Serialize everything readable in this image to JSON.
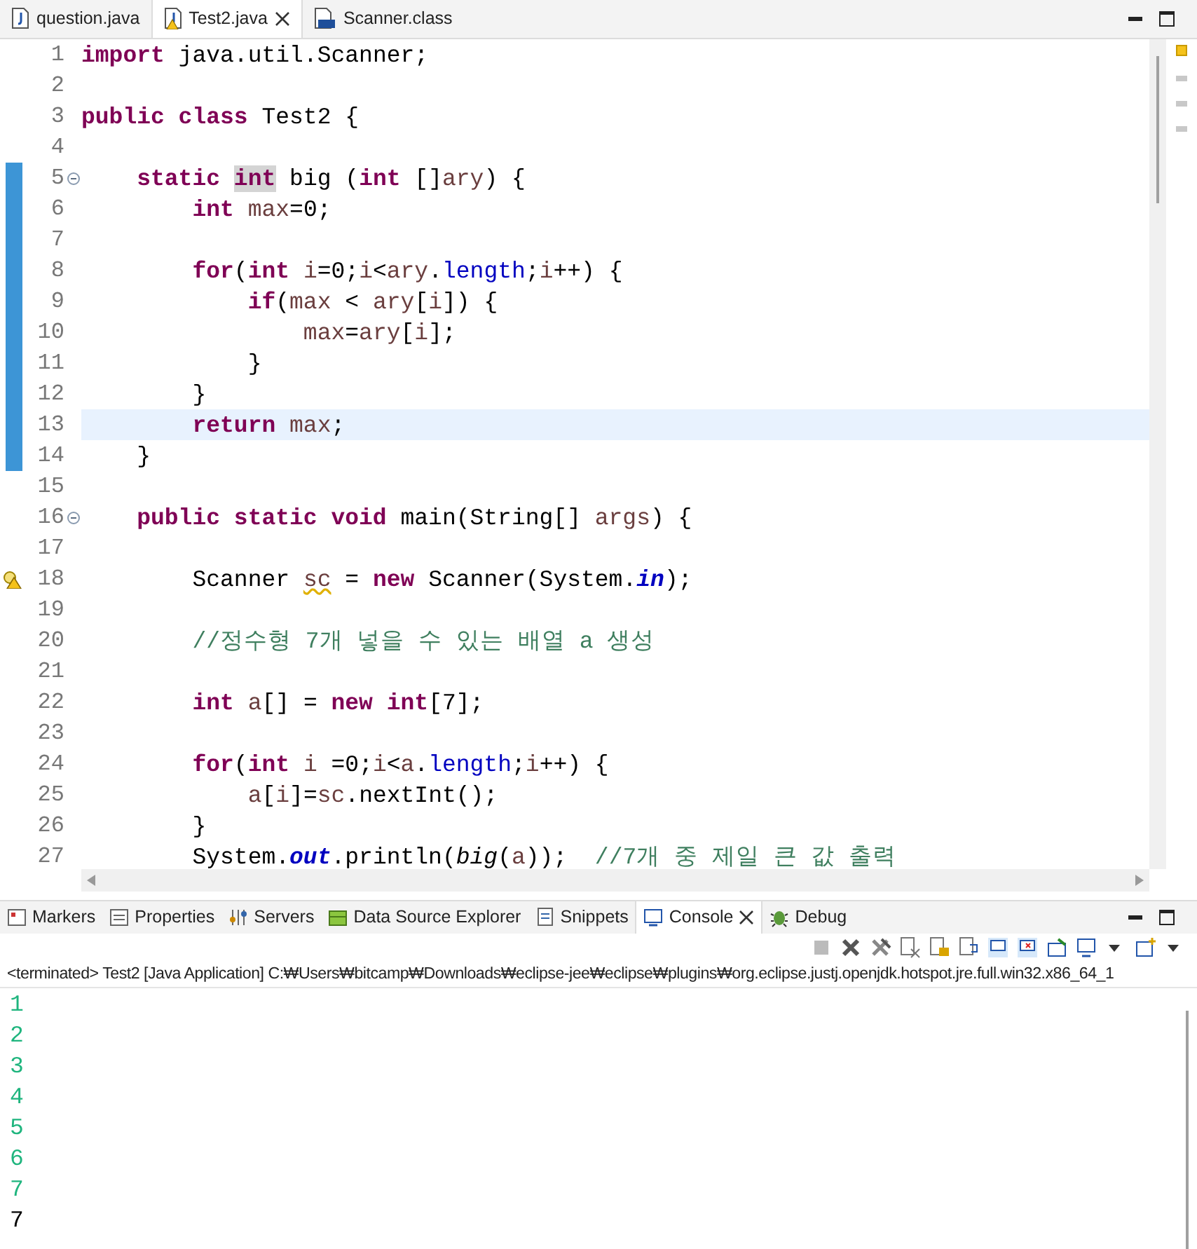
{
  "editor_tabs": [
    {
      "label": "question.java",
      "kind": "java",
      "selected": false,
      "warning": false,
      "closable": false
    },
    {
      "label": "Test2.java",
      "kind": "java",
      "selected": true,
      "warning": true,
      "closable": true
    },
    {
      "label": "Scanner.class",
      "kind": "class",
      "selected": false,
      "warning": false,
      "closable": false
    }
  ],
  "code": {
    "lines": [
      {
        "number": "1",
        "tokens": [
          {
            "kind": "keyword",
            "text": "import"
          },
          {
            "kind": "plain",
            "text": " java.util.Scanner;"
          }
        ]
      },
      {
        "number": "2"
      },
      {
        "number": "3",
        "tokens": [
          {
            "kind": "keyword",
            "text": "public class"
          },
          {
            "kind": "plain",
            "text": " Test2 {"
          }
        ]
      },
      {
        "number": "4"
      },
      {
        "number": "5",
        "foldable": true,
        "changed": true,
        "tokens": [
          {
            "kind": "keyword",
            "text": "    static "
          },
          {
            "kind": "keyword",
            "text": "int",
            "marked": true
          },
          {
            "kind": "plain",
            "text": " big ("
          },
          {
            "kind": "keyword",
            "text": "int"
          },
          {
            "kind": "plain",
            "text": " []"
          },
          {
            "kind": "variable",
            "text": "ary"
          },
          {
            "kind": "plain",
            "text": ") {"
          }
        ]
      },
      {
        "number": "6",
        "changed": true,
        "tokens": [
          {
            "kind": "keyword",
            "text": "        int "
          },
          {
            "kind": "variable",
            "text": "max"
          },
          {
            "kind": "plain",
            "text": "=0;"
          }
        ]
      },
      {
        "number": "7",
        "changed": true
      },
      {
        "number": "8",
        "changed": true,
        "tokens": [
          {
            "kind": "keyword",
            "text": "        for"
          },
          {
            "kind": "plain",
            "text": "("
          },
          {
            "kind": "keyword",
            "text": "int "
          },
          {
            "kind": "variable",
            "text": "i"
          },
          {
            "kind": "plain",
            "text": "=0;"
          },
          {
            "kind": "variable",
            "text": "i"
          },
          {
            "kind": "plain",
            "text": "<"
          },
          {
            "kind": "variable",
            "text": "ary"
          },
          {
            "kind": "plain",
            "text": "."
          },
          {
            "kind": "field",
            "text": "length"
          },
          {
            "kind": "plain",
            "text": ";"
          },
          {
            "kind": "variable",
            "text": "i"
          },
          {
            "kind": "plain",
            "text": "++) {"
          }
        ]
      },
      {
        "number": "9",
        "changed": true,
        "tokens": [
          {
            "kind": "keyword",
            "text": "            if"
          },
          {
            "kind": "plain",
            "text": "("
          },
          {
            "kind": "variable",
            "text": "max"
          },
          {
            "kind": "plain",
            "text": " < "
          },
          {
            "kind": "variable",
            "text": "ary"
          },
          {
            "kind": "plain",
            "text": "["
          },
          {
            "kind": "variable",
            "text": "i"
          },
          {
            "kind": "plain",
            "text": "]) {"
          }
        ]
      },
      {
        "number": "10",
        "changed": true,
        "tokens": [
          {
            "kind": "variable",
            "text": "                max"
          },
          {
            "kind": "plain",
            "text": "="
          },
          {
            "kind": "variable",
            "text": "ary"
          },
          {
            "kind": "plain",
            "text": "["
          },
          {
            "kind": "variable",
            "text": "i"
          },
          {
            "kind": "plain",
            "text": "];"
          }
        ]
      },
      {
        "number": "11",
        "changed": true,
        "tokens": [
          {
            "kind": "plain",
            "text": "            }"
          }
        ]
      },
      {
        "number": "12",
        "changed": true,
        "tokens": [
          {
            "kind": "plain",
            "text": "        }"
          }
        ]
      },
      {
        "number": "13",
        "changed": true,
        "current": true,
        "tokens": [
          {
            "kind": "keyword",
            "text": "        return "
          },
          {
            "kind": "variable",
            "text": "max"
          },
          {
            "kind": "plain",
            "text": ";"
          }
        ]
      },
      {
        "number": "14",
        "changed": true,
        "tokens": [
          {
            "kind": "plain",
            "text": "    }"
          }
        ]
      },
      {
        "number": "15"
      },
      {
        "number": "16",
        "foldable": true,
        "tokens": [
          {
            "kind": "keyword",
            "text": "    public static void"
          },
          {
            "kind": "plain",
            "text": " main(String[] "
          },
          {
            "kind": "variable",
            "text": "args"
          },
          {
            "kind": "plain",
            "text": ") {"
          }
        ]
      },
      {
        "number": "17"
      },
      {
        "number": "18",
        "warning": true,
        "tokens": [
          {
            "kind": "plain",
            "text": "        Scanner "
          },
          {
            "kind": "variable",
            "text": "sc",
            "squiggle": true
          },
          {
            "kind": "plain",
            "text": " = "
          },
          {
            "kind": "keyword",
            "text": "new"
          },
          {
            "kind": "plain",
            "text": " Scanner(System."
          },
          {
            "kind": "static-field",
            "text": "in"
          },
          {
            "kind": "plain",
            "text": ");"
          }
        ]
      },
      {
        "number": "19"
      },
      {
        "number": "20",
        "tokens": [
          {
            "kind": "comment",
            "text": "        //정수형 7개 넣을 수 있는 배열 a 생성"
          }
        ]
      },
      {
        "number": "21"
      },
      {
        "number": "22",
        "tokens": [
          {
            "kind": "keyword",
            "text": "        int "
          },
          {
            "kind": "variable",
            "text": "a"
          },
          {
            "kind": "plain",
            "text": "[] = "
          },
          {
            "kind": "keyword",
            "text": "new int"
          },
          {
            "kind": "plain",
            "text": "[7];"
          }
        ]
      },
      {
        "number": "23"
      },
      {
        "number": "24",
        "tokens": [
          {
            "kind": "keyword",
            "text": "        for"
          },
          {
            "kind": "plain",
            "text": "("
          },
          {
            "kind": "keyword",
            "text": "int "
          },
          {
            "kind": "variable",
            "text": "i"
          },
          {
            "kind": "plain",
            "text": " =0;"
          },
          {
            "kind": "variable",
            "text": "i"
          },
          {
            "kind": "plain",
            "text": "<"
          },
          {
            "kind": "variable",
            "text": "a"
          },
          {
            "kind": "plain",
            "text": "."
          },
          {
            "kind": "field",
            "text": "length"
          },
          {
            "kind": "plain",
            "text": ";"
          },
          {
            "kind": "variable",
            "text": "i"
          },
          {
            "kind": "plain",
            "text": "++) {"
          }
        ]
      },
      {
        "number": "25",
        "tokens": [
          {
            "kind": "variable",
            "text": "            a"
          },
          {
            "kind": "plain",
            "text": "["
          },
          {
            "kind": "variable",
            "text": "i"
          },
          {
            "kind": "plain",
            "text": "]="
          },
          {
            "kind": "variable",
            "text": "sc"
          },
          {
            "kind": "plain",
            "text": ".nextInt();"
          }
        ]
      },
      {
        "number": "26",
        "tokens": [
          {
            "kind": "plain",
            "text": "        }"
          }
        ]
      },
      {
        "number": "27",
        "tokens": [
          {
            "kind": "plain",
            "text": "        System."
          },
          {
            "kind": "static-field",
            "text": "out"
          },
          {
            "kind": "plain",
            "text": ".println("
          },
          {
            "kind": "static-method",
            "text": "big"
          },
          {
            "kind": "plain",
            "text": "("
          },
          {
            "kind": "variable",
            "text": "a"
          },
          {
            "kind": "plain",
            "text": "));  "
          },
          {
            "kind": "comment",
            "text": "//7개 중 제일 큰 값 출력"
          }
        ]
      }
    ]
  },
  "panel_tabs": [
    {
      "label": "Markers",
      "selected": false,
      "closable": false
    },
    {
      "label": "Properties",
      "selected": false,
      "closable": false
    },
    {
      "label": "Servers",
      "selected": false,
      "closable": false
    },
    {
      "label": "Data Source Explorer",
      "selected": false,
      "closable": false
    },
    {
      "label": "Snippets",
      "selected": false,
      "closable": false
    },
    {
      "label": "Console",
      "selected": true,
      "closable": true
    },
    {
      "label": "Debug",
      "selected": false,
      "closable": false
    }
  ],
  "console": {
    "status": "<terminated> Test2 [Java Application] C:₩Users₩bitcamp₩Downloads₩eclipse-jee₩eclipse₩plugins₩org.eclipse.justj.openjdk.hotspot.jre.full.win32.x86_64_1",
    "lines": [
      {
        "kind": "input",
        "text": "1"
      },
      {
        "kind": "input",
        "text": "2"
      },
      {
        "kind": "input",
        "text": "3"
      },
      {
        "kind": "input",
        "text": "4"
      },
      {
        "kind": "input",
        "text": "5"
      },
      {
        "kind": "input",
        "text": "6"
      },
      {
        "kind": "input",
        "text": "7"
      },
      {
        "kind": "output",
        "text": "7"
      }
    ]
  }
}
